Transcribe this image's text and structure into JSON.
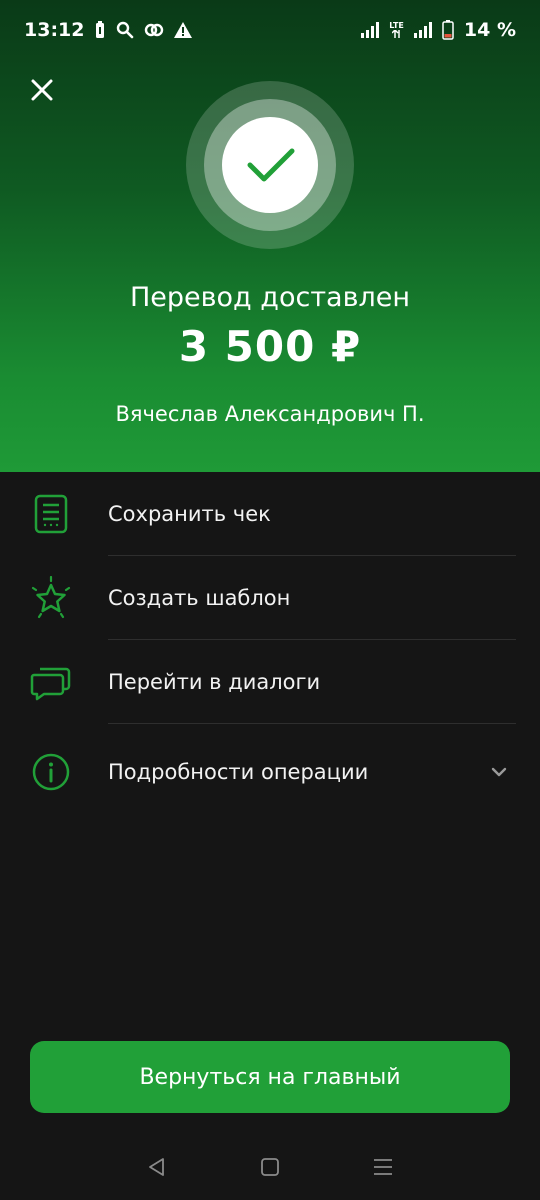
{
  "status_bar": {
    "time": "13:12",
    "battery_percent": "14 %",
    "network": "LTE",
    "icons": [
      "battery-saver-icon",
      "search-icon",
      "link-icon",
      "warning-icon",
      "wifi-icon",
      "signal-icon",
      "battery-icon"
    ]
  },
  "header": {
    "title": "Перевод доставлен",
    "amount": "3 500 ₽",
    "recipient": "Вячеслав Александрович П."
  },
  "actions": [
    {
      "label": "Сохранить чек",
      "icon": "receipt-icon"
    },
    {
      "label": "Создать шаблон",
      "icon": "star-icon"
    },
    {
      "label": "Перейти в диалоги",
      "icon": "chat-icon"
    },
    {
      "label": "Подробности операции",
      "icon": "info-icon"
    }
  ],
  "home_button": {
    "label": "Вернуться на главный"
  },
  "colors": {
    "accent": "#21a038",
    "icon_green": "#21a038",
    "background": "#151515"
  }
}
